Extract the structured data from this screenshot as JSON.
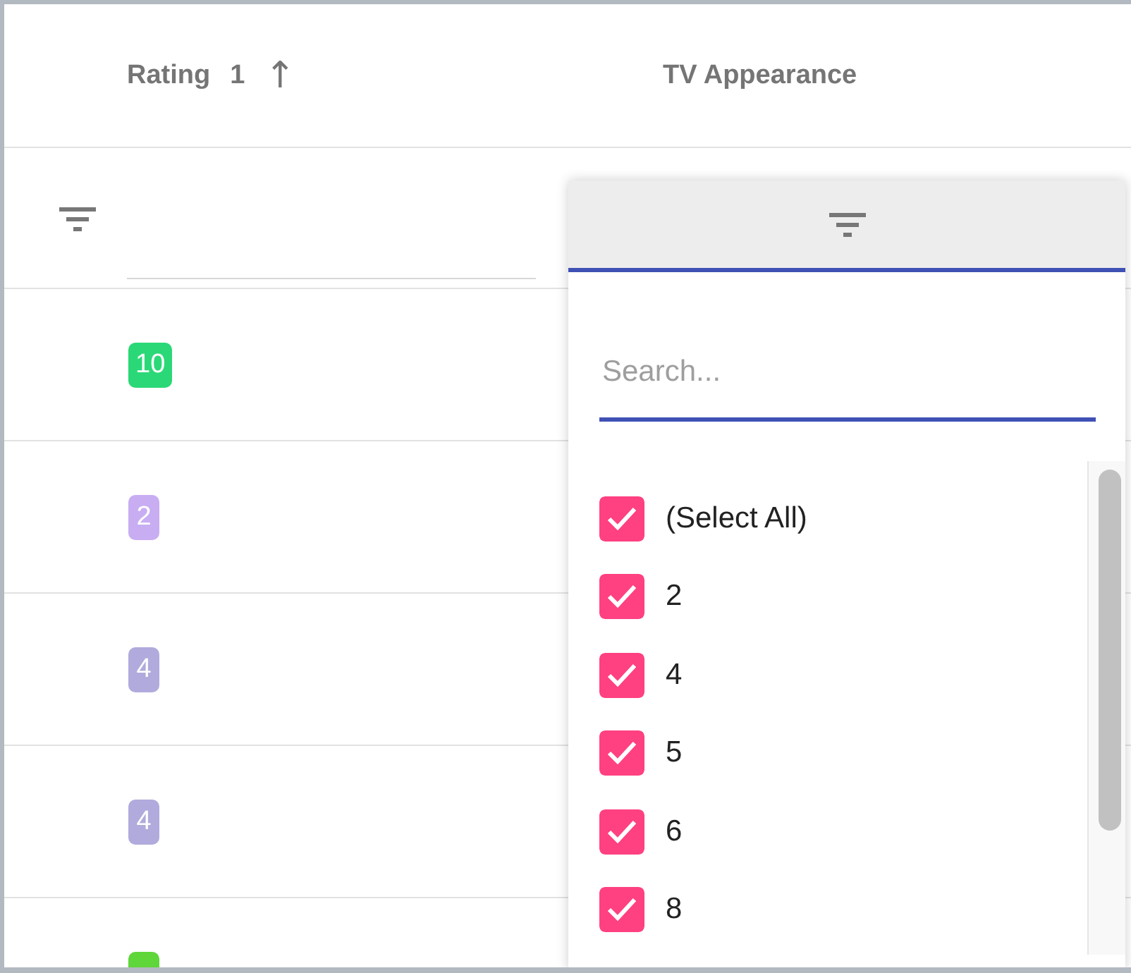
{
  "columns": [
    {
      "label": "Rating",
      "sort_order": "1",
      "sort_icon": "↑"
    },
    {
      "label": "TV Appearance"
    }
  ],
  "rows": [
    {
      "rating": "10",
      "color": "#2ad877"
    },
    {
      "rating": "2",
      "color": "#c8adf3"
    },
    {
      "rating": "4",
      "color": "#b0abdc"
    },
    {
      "rating": "4",
      "color": "#b0abdc"
    },
    {
      "color": "#5fd63a"
    }
  ],
  "filter_popup": {
    "search": {
      "placeholder": "Search..."
    },
    "options": [
      {
        "label": "(Select All)",
        "checked": true
      },
      {
        "label": "2",
        "checked": true
      },
      {
        "label": "4",
        "checked": true
      },
      {
        "label": "5",
        "checked": true
      },
      {
        "label": "6",
        "checked": true
      },
      {
        "label": "8",
        "checked": true
      }
    ]
  }
}
